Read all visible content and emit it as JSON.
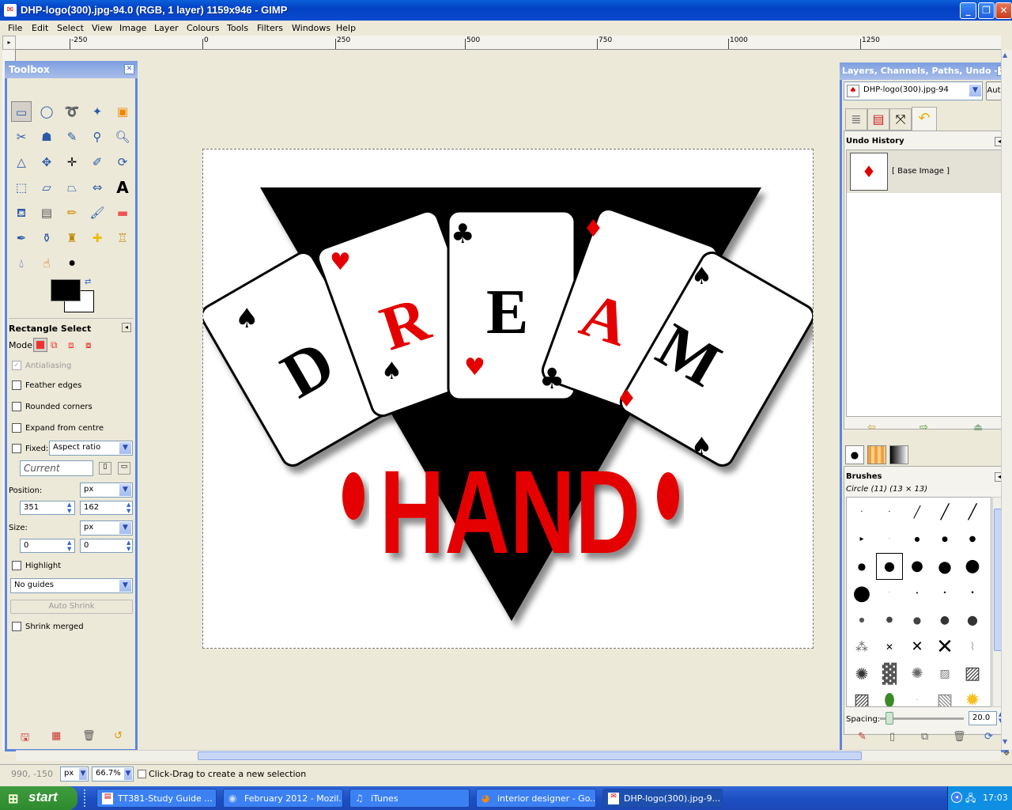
{
  "window": {
    "title": "DHP-logo(300).jpg-94.0 (RGB, 1 layer) 1159x946 - GIMP"
  },
  "menu": [
    "File",
    "Edit",
    "Select",
    "View",
    "Image",
    "Layer",
    "Colours",
    "Tools",
    "Filters",
    "Windows",
    "Help"
  ],
  "ruler": {
    "labels": [
      "-250",
      "0",
      "250",
      "500",
      "750",
      "1000",
      "1250"
    ]
  },
  "toolbox": {
    "title": "Toolbox",
    "tool_options_title": "Rectangle Select",
    "mode_label": "Mode:",
    "antialiasing": "Antialiasing",
    "feather_edges": "Feather edges",
    "rounded_corners": "Rounded corners",
    "expand_from_centre": "Expand from centre",
    "fixed_label": "Fixed:",
    "fixed_value": "Aspect ratio",
    "current_value": "Current",
    "position_label": "Position:",
    "position_unit": "px",
    "position_x": "351",
    "position_y": "162",
    "size_label": "Size:",
    "size_unit": "px",
    "size_w": "0",
    "size_h": "0",
    "highlight": "Highlight",
    "guides": "No guides",
    "auto_shrink": "Auto Shrink",
    "shrink_merged": "Shrink merged"
  },
  "dock": {
    "title": "Layers, Channels, Paths, Undo - B...",
    "image_select": "DHP-logo(300).jpg-94",
    "auto_button": "Auto",
    "undo_title": "Undo History",
    "undo_item": "[ Base Image ]",
    "brushes_title": "Brushes",
    "brush_name": "Circle (11) (13 × 13)",
    "spacing_label": "Spacing:",
    "spacing_value": "20.0"
  },
  "logo": {
    "letters": [
      "D",
      "R",
      "E",
      "A",
      "M"
    ],
    "hand": "HAND"
  },
  "status": {
    "coords": "990, -150",
    "unit": "px",
    "zoom": "66.7%",
    "message": "Click-Drag to create a new selection"
  },
  "taskbar": {
    "start": "start",
    "tasks": [
      "TT381-Study Guide ...",
      "February 2012 - Mozil...",
      "iTunes",
      "interior designer - Go...",
      "DHP-logo(300).jpg-9..."
    ],
    "clock": "17:03"
  },
  "colors": {
    "accent": "#5d86dd",
    "logo_red": "#e40000",
    "logo_black": "#000000"
  }
}
